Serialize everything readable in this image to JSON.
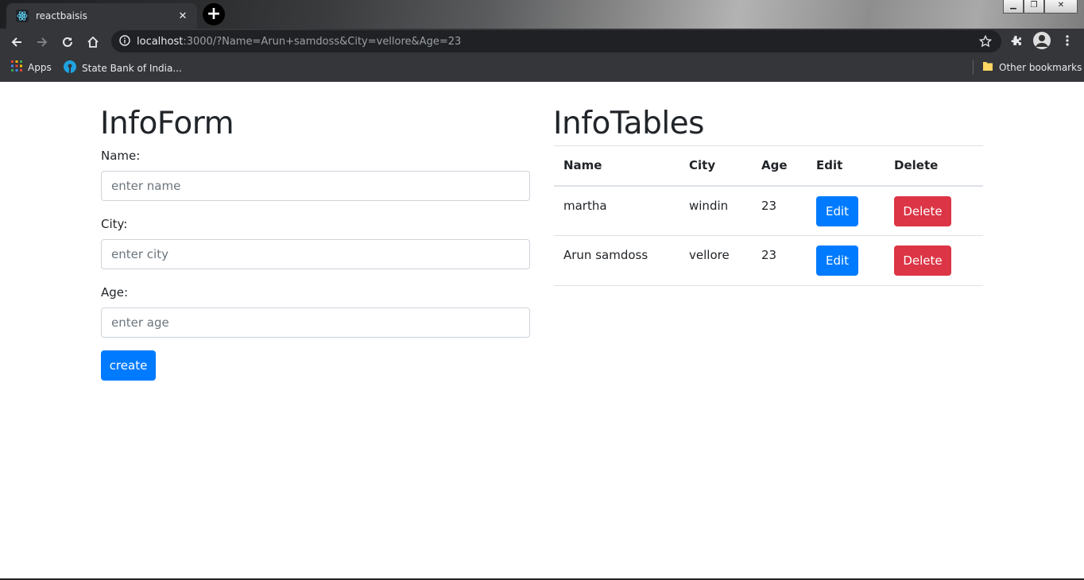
{
  "browser": {
    "tab_title": "reactbaisis",
    "tab_close": "✕",
    "new_tab": "+",
    "url_host": "localhost",
    "url_rest": ":3000/?Name=Arun+samdoss&City=vellore&Age=23",
    "bookmarks": [
      {
        "label": "Apps",
        "icon": "apps-grid-icon"
      },
      {
        "label": "State Bank of India...",
        "icon": "sbi-icon"
      }
    ],
    "other_bookmarks": "Other bookmarks"
  },
  "form": {
    "title": "InfoForm",
    "name_label": "Name:",
    "name_placeholder": "enter name",
    "city_label": "City:",
    "city_placeholder": "enter city",
    "age_label": "Age:",
    "age_placeholder": "enter age",
    "submit_label": "create"
  },
  "table": {
    "title": "InfoTables",
    "headers": [
      "Name",
      "City",
      "Age",
      "Edit",
      "Delete"
    ],
    "rows": [
      {
        "name": "martha",
        "city": "windin",
        "age": "23",
        "edit": "Edit",
        "delete": "Delete"
      },
      {
        "name": "Arun samdoss",
        "city": "vellore",
        "age": "23",
        "edit": "Edit",
        "delete": "Delete"
      }
    ]
  },
  "colors": {
    "primary": "#007bff",
    "danger": "#dc3545",
    "chrome_dark": "#35363a"
  }
}
